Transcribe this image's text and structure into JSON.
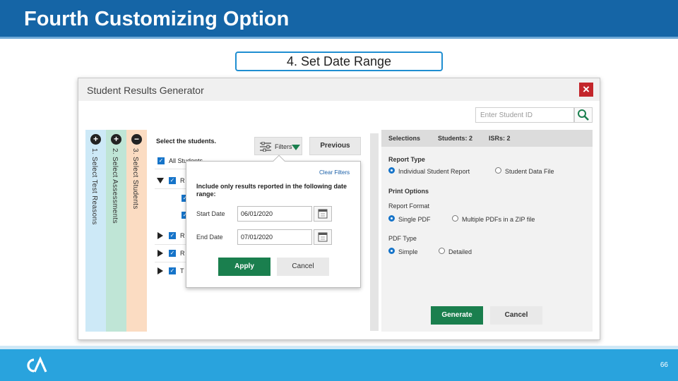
{
  "slide": {
    "title": "Fourth Customizing Option",
    "callout": "4. Set Date Range",
    "page_number": "66"
  },
  "colors": {
    "header_blue": "#1565a6",
    "footer_blue": "#29a3dd",
    "action_green": "#1a7f4e",
    "close_red": "#c3262b",
    "checkbox_blue": "#1674c9"
  },
  "dialog": {
    "title": "Student Results Generator",
    "close_icon": "close-icon",
    "student_id_placeholder": "Enter Student ID",
    "steps": [
      {
        "icon": "+",
        "label": "1. Select Test Reasons"
      },
      {
        "icon": "+",
        "label": "2. Select Assessments"
      },
      {
        "icon": "−",
        "label": "3. Select Students"
      }
    ],
    "select_heading": "Select the students.",
    "filters_label": "Filters",
    "previous_label": "Previous",
    "students": {
      "all_label": "All Students",
      "rows": [
        {
          "label": "R"
        },
        {
          "label": "R"
        },
        {
          "label": "R"
        },
        {
          "label": "T"
        }
      ]
    },
    "filter_popover": {
      "clear_label": "Clear Filters",
      "message": "Include only results reported in the following date range:",
      "start_label": "Start Date",
      "start_value": "06/01/2020",
      "end_label": "End Date",
      "end_value": "07/01/2020",
      "apply_label": "Apply",
      "cancel_label": "Cancel"
    },
    "selections": {
      "tabs": [
        "Selections",
        "Students: 2",
        "ISRs: 2"
      ],
      "report_type_label": "Report Type",
      "report_type_options": [
        "Individual Student Report",
        "Student Data File"
      ],
      "report_type_selected": "Individual Student Report",
      "print_options_label": "Print Options",
      "report_format_label": "Report Format",
      "report_format_options": [
        "Single PDF",
        "Multiple PDFs in a ZIP file"
      ],
      "report_format_selected": "Single PDF",
      "pdf_type_label": "PDF Type",
      "pdf_type_options": [
        "Simple",
        "Detailed"
      ],
      "pdf_type_selected": "Simple",
      "generate_label": "Generate",
      "cancel_label": "Cancel"
    }
  }
}
